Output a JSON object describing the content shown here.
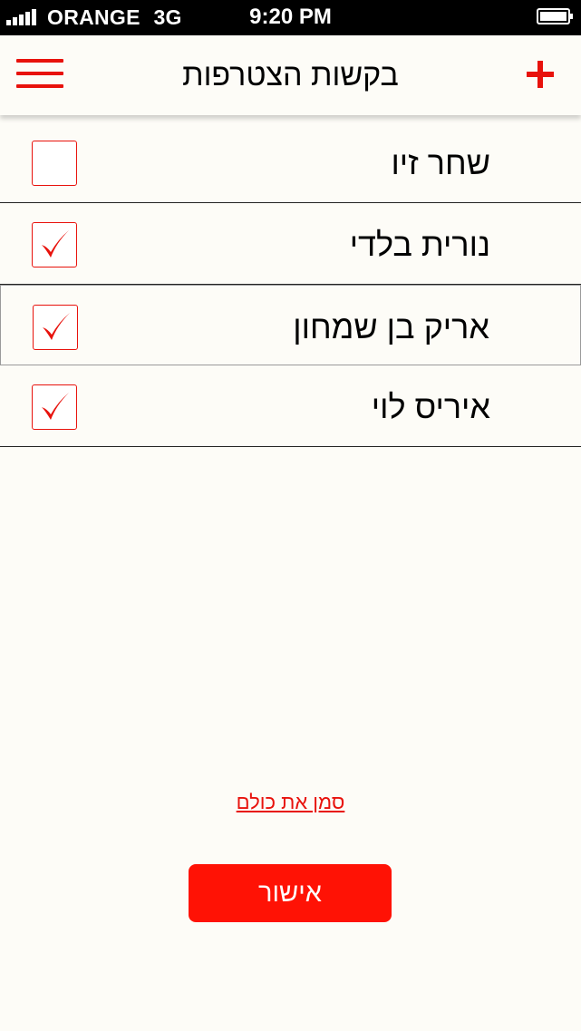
{
  "status_bar": {
    "carrier": "ORANGE",
    "network": "3G",
    "time": "9:20 PM"
  },
  "header": {
    "title": "בקשות הצטרפות",
    "menu_icon": "hamburger-menu-icon",
    "add_icon": "plus-icon"
  },
  "requests": [
    {
      "name": "שחר זיו",
      "checked": false
    },
    {
      "name": "נורית בלדי",
      "checked": true
    },
    {
      "name": "אריק בן שמחון",
      "checked": true
    },
    {
      "name": "איריס לוי",
      "checked": true
    }
  ],
  "actions": {
    "select_all": "סמן את כולם",
    "confirm": "אישור"
  },
  "colors": {
    "accent": "#e8120c",
    "button": "#ff1205",
    "background": "#fdfcf7"
  }
}
